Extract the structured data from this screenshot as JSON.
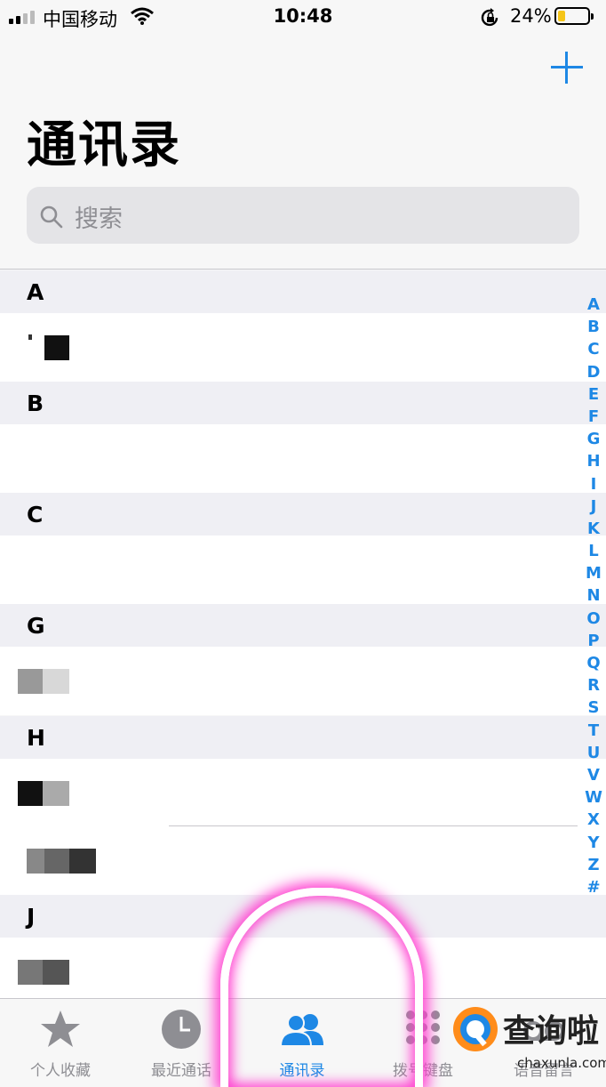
{
  "status_bar": {
    "carrier": "中国移动",
    "time": "10:48",
    "battery_percent": "24%",
    "battery_level": 0.24,
    "icons": [
      "signal-icon",
      "wifi-icon",
      "rotation-lock-icon",
      "battery-icon"
    ]
  },
  "header": {
    "add_icon": "plus-icon",
    "title": "通讯录"
  },
  "search": {
    "placeholder": "搜索",
    "icon": "search-icon"
  },
  "sections": [
    {
      "letter": "A"
    },
    {
      "letter": "B"
    },
    {
      "letter": "C"
    },
    {
      "letter": "G"
    },
    {
      "letter": "H"
    },
    {
      "letter": "J"
    }
  ],
  "index_letters": [
    "A",
    "B",
    "C",
    "D",
    "E",
    "F",
    "G",
    "H",
    "I",
    "J",
    "K",
    "L",
    "M",
    "N",
    "O",
    "P",
    "Q",
    "R",
    "S",
    "T",
    "U",
    "V",
    "W",
    "X",
    "Y",
    "Z",
    "#"
  ],
  "tab_bar": {
    "tabs": [
      {
        "label": "个人收藏",
        "icon": "star-icon",
        "active": false
      },
      {
        "label": "最近通话",
        "icon": "clock-icon",
        "active": false
      },
      {
        "label": "通讯录",
        "icon": "contacts-icon",
        "active": true
      },
      {
        "label": "拨号键盘",
        "icon": "keypad-icon",
        "active": false
      },
      {
        "label": "语音留言",
        "icon": "voicemail-icon",
        "active": false
      }
    ]
  },
  "watermark": {
    "name": "查询啦",
    "domain": "chaxunla.com"
  },
  "colors": {
    "accent": "#1e88e5",
    "highlight": "#ff3fd0"
  }
}
